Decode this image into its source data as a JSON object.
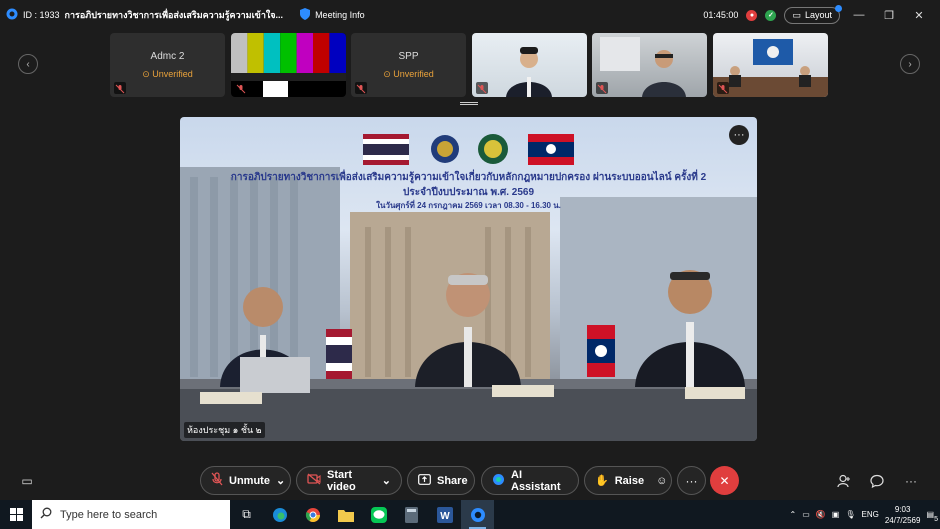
{
  "titlebar": {
    "meeting_id": "ID : 1933",
    "meeting_title": "การอภิปรายทางวิชาการเพื่อส่งเสริมความรู้ความเข้าใจ...",
    "meeting_info_label": "Meeting Info",
    "timer": "01:45:00",
    "layout_label": "Layout"
  },
  "participants": [
    {
      "name": "Admc 2",
      "status": "Unverified"
    },
    {
      "name": "",
      "status": ""
    },
    {
      "name": "SPP",
      "status": "Unverified"
    },
    {
      "name": "",
      "status": ""
    },
    {
      "name": "",
      "status": ""
    },
    {
      "name": "",
      "status": ""
    }
  ],
  "main_video": {
    "banner_line1": "การอภิปรายทางวิชาการเพื่อส่งเสริมความรู้ความเข้าใจเกี่ยวกับหลักกฎหมายปกครอง ผ่านระบบออนไลน์ ครั้งที่ 2",
    "banner_line2": "ประจำปีงบประมาณ พ.ศ. 2569",
    "banner_line3": "ในวันศุกร์ที่ 24 กรกฎาคม 2569 เวลา 08.30 - 16.30 น.",
    "caption": "ห้องประชุม ๑ ชั้น ๒"
  },
  "toolbar": {
    "unmute": "Unmute",
    "start_video": "Start video",
    "share": "Share",
    "ai_assistant": "AI Assistant",
    "raise": "Raise"
  },
  "taskbar": {
    "search_placeholder": "Type here to search",
    "lang": "ENG",
    "time": "9:03",
    "date": "24/7/2569",
    "notif_count": "5"
  },
  "colors": {
    "accent": "#2d8cff",
    "unverified": "#e9a23b",
    "end_button": "#e03e3e"
  }
}
